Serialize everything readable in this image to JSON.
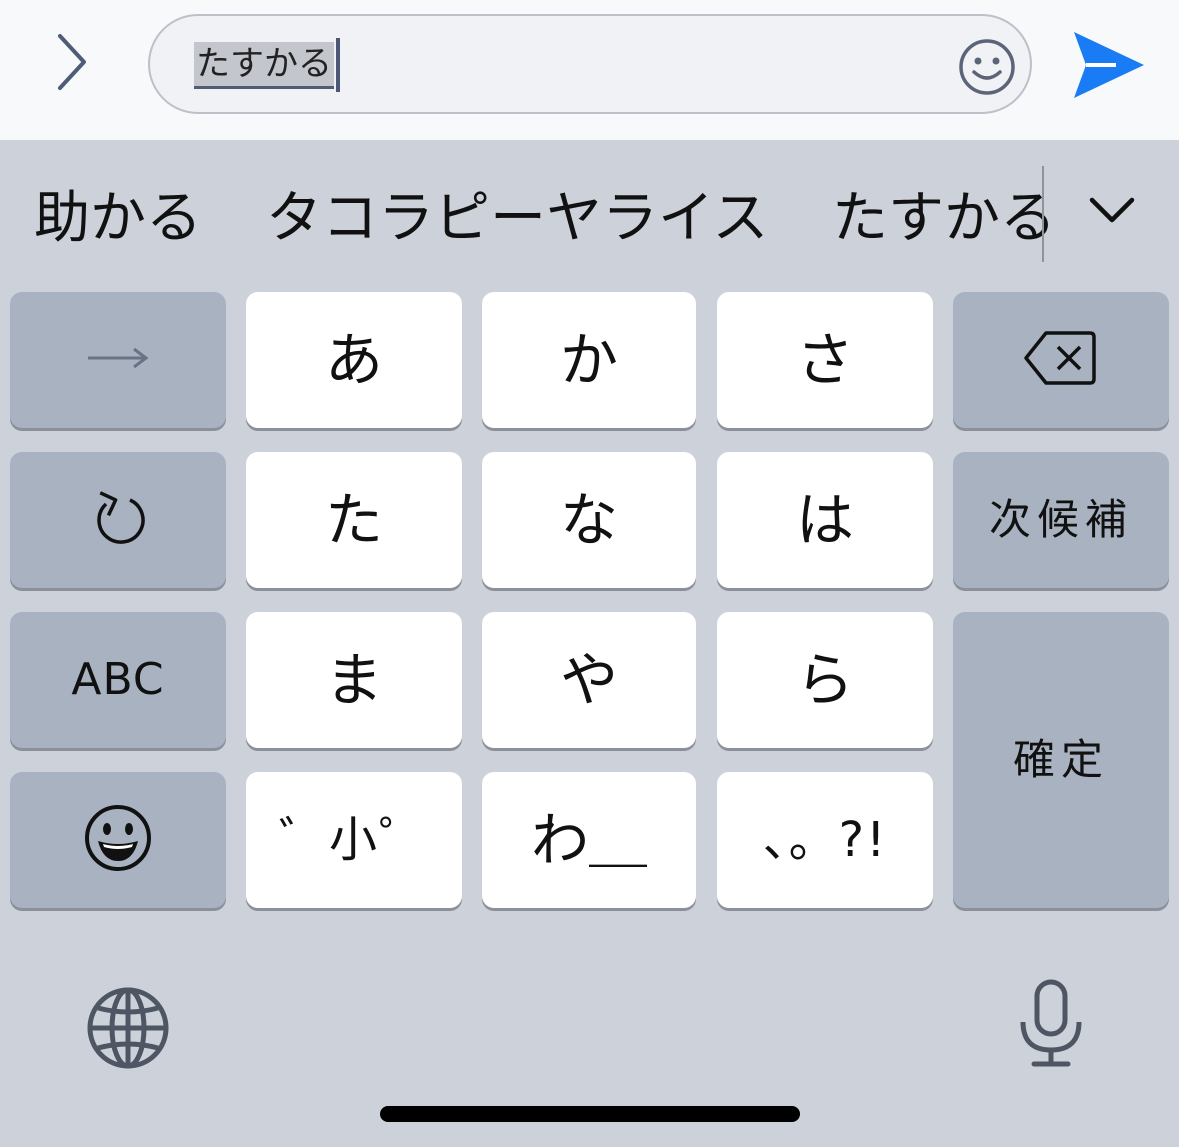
{
  "input": {
    "text": "たすかる"
  },
  "candidates": [
    "助かる",
    "タコラピーヤライス",
    "たすかる"
  ],
  "keys": {
    "row1": [
      "あ",
      "か",
      "さ"
    ],
    "row2": [
      "た",
      "な",
      "は"
    ],
    "row3": [
      "ま",
      "や",
      "ら"
    ],
    "row4": [
      "゛小゜",
      "わ＿",
      "、。?!"
    ],
    "next_candidate": "次候補",
    "abc": "ABC",
    "confirm": "確定"
  },
  "icons": {
    "expand_toolbar": "chevron-right-icon",
    "emoji_in_field": "smiley-icon",
    "send": "send-arrow-icon",
    "more_candidates": "chevron-down-icon",
    "arrow_key": "right-arrow-icon",
    "undo_key": "undo-icon",
    "emoji_key": "emoji-face-icon",
    "delete_key": "backspace-icon",
    "globe": "globe-icon",
    "dictation": "microphone-icon"
  },
  "colors": {
    "send_blue": "#1a7cf5",
    "keyboard_bg": "#cdd2da",
    "gray_key": "#a8b2c0",
    "white_key": "#ffffff"
  }
}
